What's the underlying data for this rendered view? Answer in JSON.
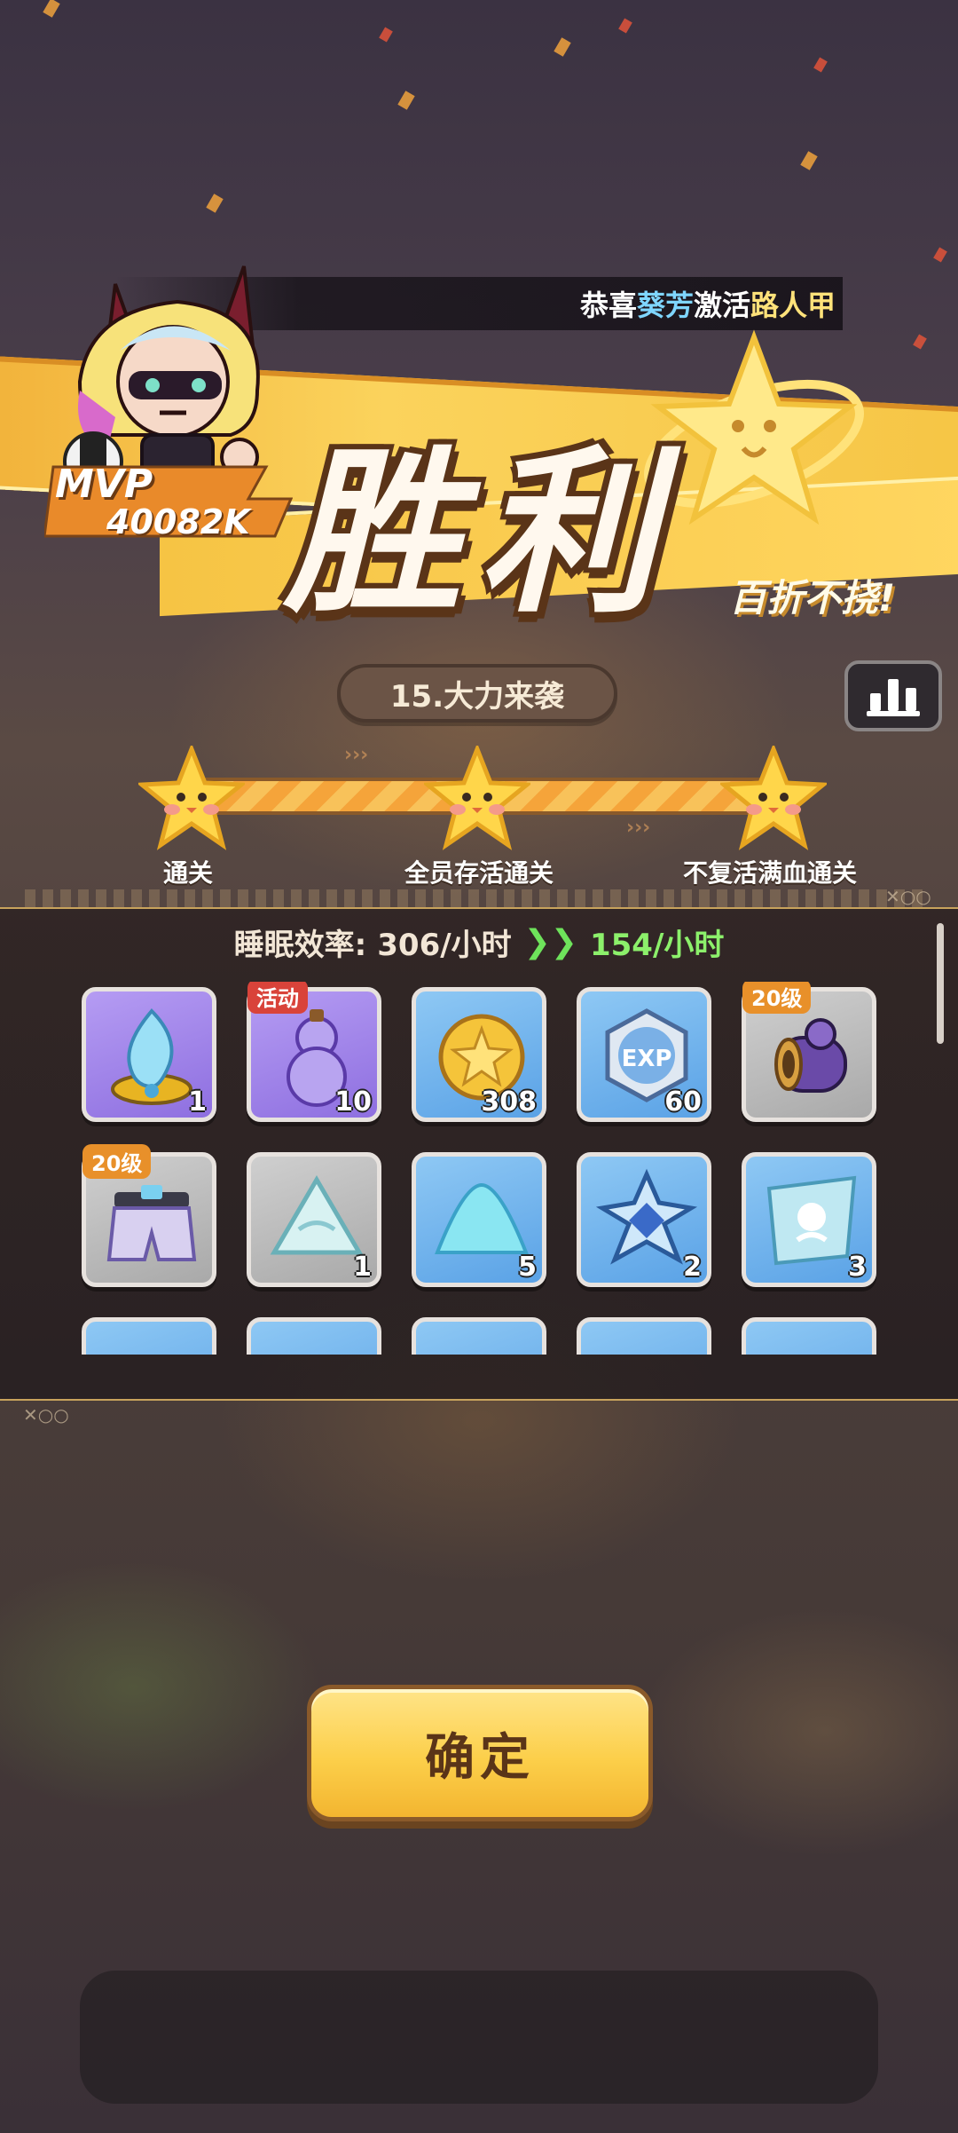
{
  "broadcast": {
    "prefix": "恭喜",
    "player": "葵芳",
    "action": "激活",
    "target": "路人甲"
  },
  "victory": {
    "title": "胜利",
    "slogan": "百折不挠!"
  },
  "mvp": {
    "label": "MVP",
    "score": "40082K"
  },
  "stage": {
    "name": "15.大力来袭"
  },
  "stats_button": {
    "icon": "bar-chart-icon"
  },
  "goals": [
    {
      "label": "通关",
      "achieved": true
    },
    {
      "label": "全员存活通关",
      "achieved": true
    },
    {
      "label": "不复活满血通关",
      "achieved": true
    }
  ],
  "sleep_efficiency": {
    "label": "睡眠效率:",
    "old_value": "306/小时",
    "new_value": "154/小时"
  },
  "rewards": [
    {
      "name": "flame-core-icon",
      "count": "1",
      "rarity": "purple",
      "tag": ""
    },
    {
      "name": "gourd-potion-icon",
      "count": "10",
      "rarity": "purple",
      "tag": "活动"
    },
    {
      "name": "gold-coin-icon",
      "count": "308",
      "rarity": "blue",
      "tag": ""
    },
    {
      "name": "exp-badge-icon",
      "count": "60",
      "rarity": "blue",
      "tag": ""
    },
    {
      "name": "gauntlet-icon",
      "count": "",
      "rarity": "gray",
      "tag": "20级"
    },
    {
      "name": "shorts-icon",
      "count": "",
      "rarity": "gray",
      "tag": "20级"
    },
    {
      "name": "ice-shard-icon",
      "count": "1",
      "rarity": "gray",
      "tag": ""
    },
    {
      "name": "crystal-powder-icon",
      "count": "5",
      "rarity": "blue",
      "tag": ""
    },
    {
      "name": "blue-gem-icon",
      "count": "2",
      "rarity": "blue",
      "tag": ""
    },
    {
      "name": "blueprint-icon",
      "count": "3",
      "rarity": "blue",
      "tag": ""
    },
    {
      "name": "item-icon",
      "count": "",
      "rarity": "blue",
      "tag": ""
    },
    {
      "name": "item-icon",
      "count": "",
      "rarity": "blue",
      "tag": ""
    },
    {
      "name": "item-icon",
      "count": "",
      "rarity": "blue",
      "tag": ""
    },
    {
      "name": "item-icon",
      "count": "",
      "rarity": "blue",
      "tag": ""
    },
    {
      "name": "item-icon",
      "count": "",
      "rarity": "blue",
      "tag": ""
    }
  ],
  "confirm_button": {
    "label": "确定"
  },
  "colors": {
    "ribbon": "#f6c545",
    "title_outline": "#5a3418",
    "highlight_green": "#8cf06b",
    "player_name": "#7fd6ff"
  }
}
